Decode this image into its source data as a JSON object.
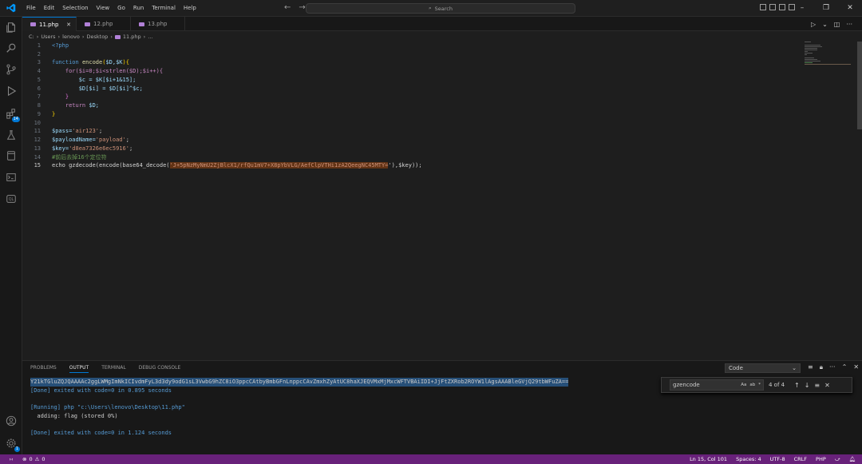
{
  "menu": [
    "File",
    "Edit",
    "Selection",
    "View",
    "Go",
    "Run",
    "Terminal",
    "Help"
  ],
  "search": {
    "label": "Search"
  },
  "tabs": [
    {
      "label": "11.php",
      "active": true
    },
    {
      "label": "12.php",
      "active": false
    },
    {
      "label": "13.php",
      "active": false
    }
  ],
  "breadcrumb": [
    "C:",
    "Users",
    "lenovo",
    "Desktop",
    "11.php",
    "..."
  ],
  "code": {
    "line_numbers": [
      "1",
      "2",
      "3",
      "4",
      "5",
      "6",
      "7",
      "8",
      "9",
      "10",
      "11",
      "12",
      "13",
      "14",
      "15"
    ],
    "l1": "<?php",
    "l3_kw": "function",
    "l3_fn": "encode",
    "l3_params": "$D,$K",
    "l4": "for($i=0;$i<strlen($D);$i++){",
    "l5": "$c = $K[$i+1&15];",
    "l6": "$D[$i] = $D[$i]^$c;",
    "l7": "}",
    "l8_kw": "return",
    "l8_var": "$D;",
    "l9": "}",
    "l11_var": "$pass=",
    "l11_str": "'air123'",
    "l12_var": "$payloadName=",
    "l12_str": "'payload'",
    "l13_var": "$key=",
    "l13_str": "'d8ea7326e6ec5916'",
    "l14_comment": "#前后去掉16个定位符",
    "l15_a": "echo gzdecode(encode(base64_decode(",
    "l15_str": "'J+5pNzMyNmU2ZjBlcX1/rfQu1mV7+X8pYbVLG/AefClpVTHi1zA2QeegNC45MTY=",
    "l15_end": "'),$key));"
  },
  "panel": {
    "tabs": [
      "PROBLEMS",
      "OUTPUT",
      "TERMINAL",
      "DEBUG CONSOLE"
    ],
    "active_tab": "OUTPUT",
    "channel": "Code",
    "output": [
      "Y21kTGluZQJQAAAAc2ggLWMgImNkICIvdmFyL3d3dy9odG1sL3VwbG9hZC8iO3ppcCAtbyBmbGFnLnppcCAvZmxhZyAtUC8haXJEQVMxMjMxcWFTVBAiIDI+JjFtZXRob2ROYW1lAgsAAABleGVjQ29tbWFuZA==",
      "[Done] exited with code=0 in 0.895 seconds",
      "",
      "[Running] php \"c:\\Users\\lenovo\\Desktop\\11.php\"",
      "  adding: flag (stored 0%)",
      "",
      "[Done] exited with code=0 in 1.124 seconds"
    ]
  },
  "find": {
    "value": "gzencode",
    "options": [
      "Aa",
      "ab",
      "*"
    ],
    "count": "4 of 4"
  },
  "status": {
    "errors": "0",
    "warnings": "0",
    "position": "Ln 15, Col 101",
    "spaces": "Spaces: 4",
    "encoding": "UTF-8",
    "eol": "CRLF",
    "language": "PHP"
  },
  "activity_badges": {
    "extensions": "14",
    "settings": "1"
  },
  "colors": {
    "statusbar": "#68217a",
    "accent": "#0078d4"
  }
}
